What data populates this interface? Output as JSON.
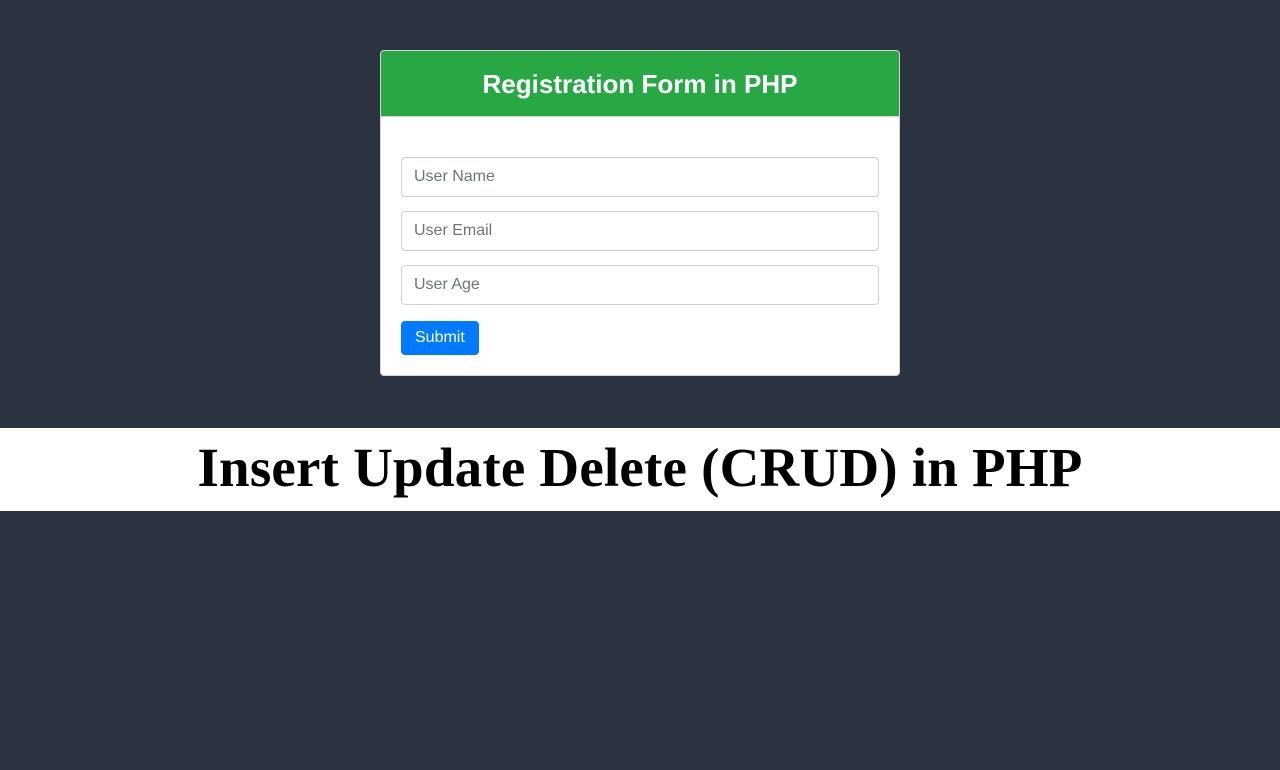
{
  "form": {
    "title": "Registration Form in PHP",
    "fields": {
      "name_placeholder": "User Name",
      "email_placeholder": "User Email",
      "age_placeholder": "User Age"
    },
    "submit_label": "Submit"
  },
  "banner": {
    "text": "Insert Update Delete (CRUD) in PHP"
  }
}
